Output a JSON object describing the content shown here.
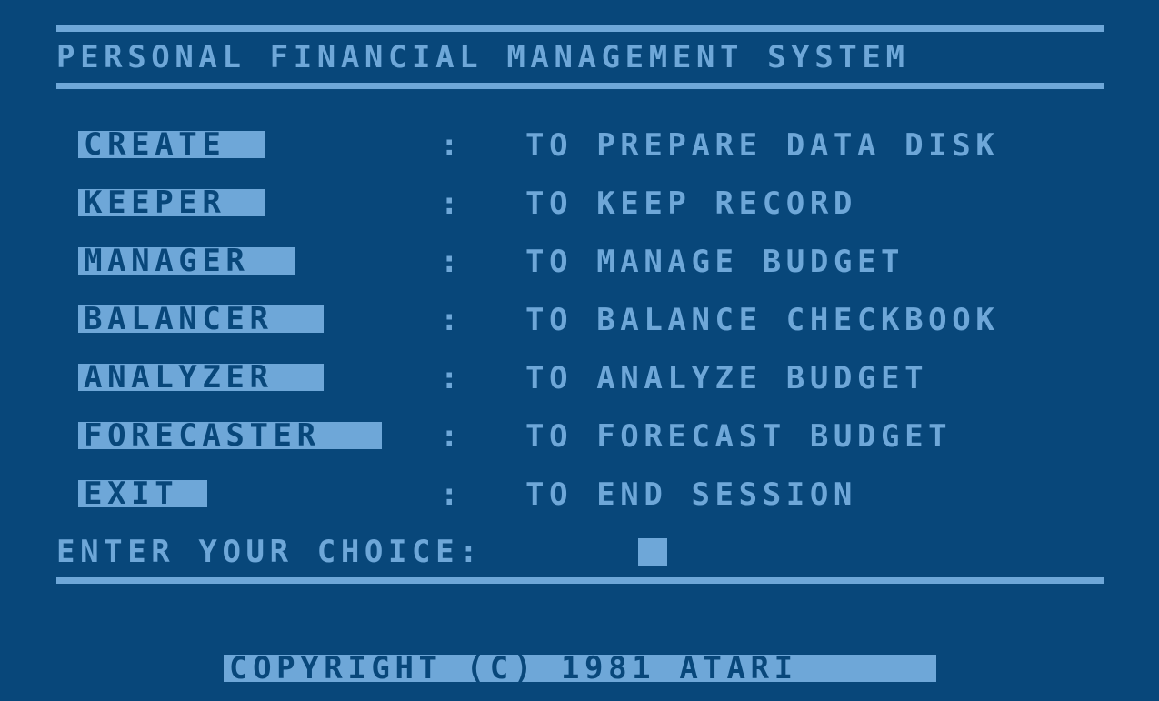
{
  "title": "PERSONAL FINANCIAL MANAGEMENT SYSTEM",
  "menu": [
    {
      "key": "CREATE",
      "desc": "TO PREPARE DATA DISK"
    },
    {
      "key": "KEEPER",
      "desc": "TO KEEP RECORD"
    },
    {
      "key": "MANAGER",
      "desc": "TO MANAGE BUDGET"
    },
    {
      "key": "BALANCER",
      "desc": "TO BALANCE CHECKBOOK"
    },
    {
      "key": "ANALYZER",
      "desc": "TO ANALYZE BUDGET"
    },
    {
      "key": "FORECASTER",
      "desc": "TO FORECAST BUDGET"
    },
    {
      "key": "EXIT",
      "desc": "TO END SESSION"
    }
  ],
  "separator": ":",
  "prompt": "ENTER YOUR CHOICE:",
  "copyright": "COPYRIGHT (C) 1981 ATARI"
}
